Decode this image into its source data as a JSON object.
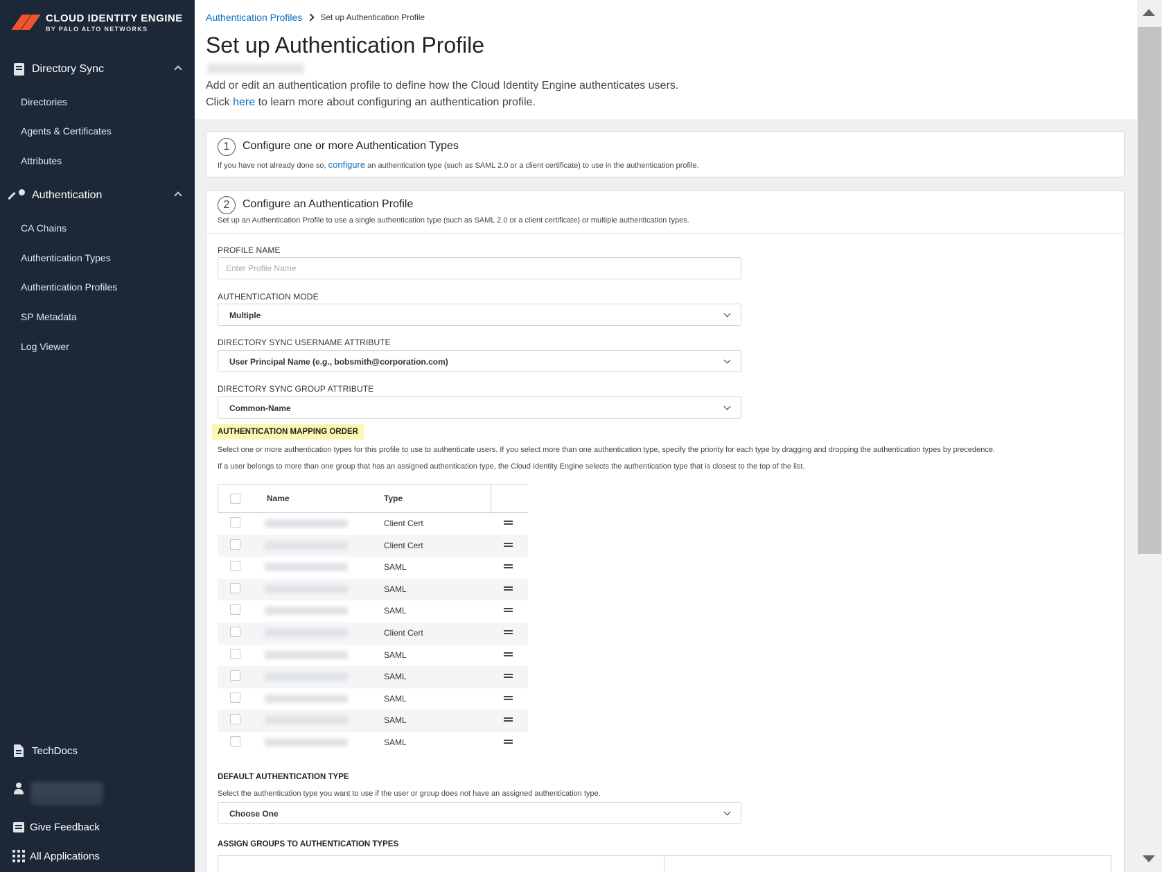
{
  "sidebar": {
    "brand_line1": "CLOUD IDENTITY ENGINE",
    "brand_line2": "BY PALO ALTO NETWORKS",
    "groups": [
      {
        "label": "Directory Sync",
        "icon": "book-icon",
        "items": [
          "Directories",
          "Agents & Certificates",
          "Attributes"
        ]
      },
      {
        "label": "Authentication",
        "icon": "key-icon",
        "items": [
          "CA Chains",
          "Authentication Types",
          "Authentication Profiles",
          "SP Metadata",
          "Log Viewer"
        ]
      }
    ],
    "bottom": {
      "techdocs": "TechDocs",
      "feedback": "Give Feedback",
      "all_apps": "All Applications"
    }
  },
  "header": {
    "breadcrumb_link": "Authentication Profiles",
    "breadcrumb_current": "Set up Authentication Profile",
    "title": "Set up Authentication Profile",
    "desc_line1": "Add or edit an authentication profile to define how the Cloud Identity Engine authenticates users.",
    "desc_line2_pre": "Click ",
    "desc_line2_link": "here",
    "desc_line2_post": " to learn more about configuring an authentication profile."
  },
  "step1": {
    "number": "1",
    "title": "Configure one or more Authentication Types",
    "desc_pre": "If you have not already done so, ",
    "desc_link": "configure",
    "desc_post": " an authentication type (such as SAML 2.0 or a client certificate) to use in the authentication profile."
  },
  "step2": {
    "number": "2",
    "title": "Configure an Authentication Profile",
    "desc": "Set up an Authentication Profile to use a single authentication type (such as SAML 2.0 or a client certificate) or multiple authentication types."
  },
  "form": {
    "profile_name_label": "PROFILE NAME",
    "profile_name_placeholder": "Enter Profile Name",
    "auth_mode_label": "AUTHENTICATION MODE",
    "auth_mode_value": "Multiple",
    "username_attr_label": "DIRECTORY SYNC USERNAME ATTRIBUTE",
    "username_attr_value": "User Principal Name (e.g., bobsmith@corporation.com)",
    "group_attr_label": "DIRECTORY SYNC GROUP ATTRIBUTE",
    "group_attr_value": "Common-Name"
  },
  "mapping": {
    "title": "AUTHENTICATION MAPPING ORDER",
    "desc1": "Select one or more authentication types for this profile to use to authenticate users. If you select more than one authentication type, specify the priority for each type by dragging and dropping the authentication types by precedence.",
    "desc2": "If a user belongs to more than one group that has an assigned authentication type, the Cloud Identity Engine selects the authentication type that is closest to the top of the list.",
    "columns": {
      "name": "Name",
      "type": "Type"
    },
    "rows": [
      {
        "type": "Client Cert"
      },
      {
        "type": "Client Cert"
      },
      {
        "type": "SAML"
      },
      {
        "type": "SAML"
      },
      {
        "type": "SAML"
      },
      {
        "type": "Client Cert"
      },
      {
        "type": "SAML"
      },
      {
        "type": "SAML"
      },
      {
        "type": "SAML"
      },
      {
        "type": "SAML"
      },
      {
        "type": "SAML"
      }
    ]
  },
  "default_auth": {
    "title": "DEFAULT AUTHENTICATION TYPE",
    "desc": "Select the authentication type you want to use if the user or group does not have an assigned authentication type.",
    "value": "Choose One"
  },
  "assign_groups": {
    "title": "ASSIGN GROUPS TO AUTHENTICATION TYPES"
  }
}
